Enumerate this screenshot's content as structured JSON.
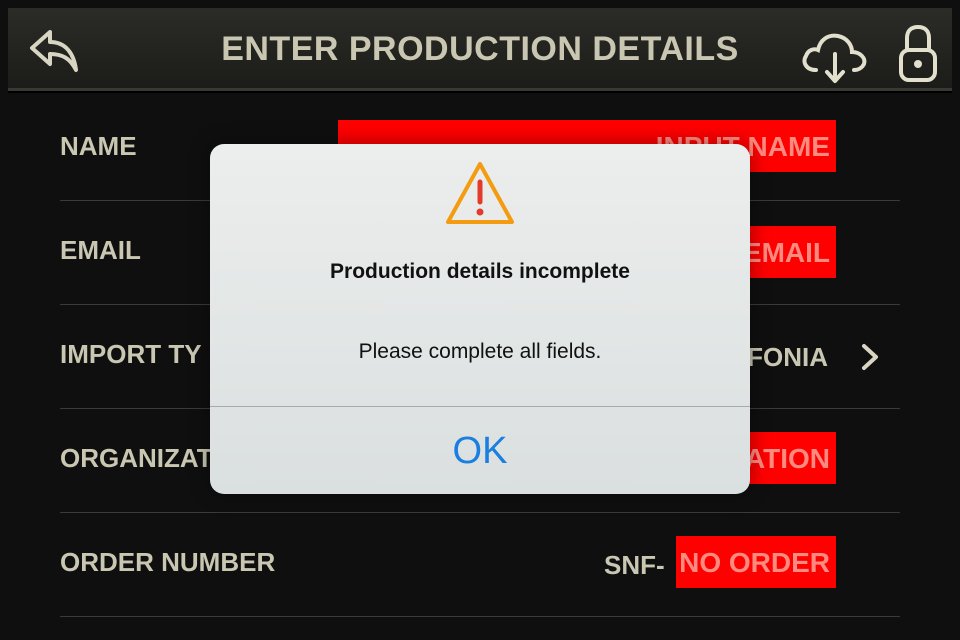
{
  "header": {
    "title": "ENTER PRODUCTION DETAILS",
    "back_icon": "back-arrow-icon",
    "cloud_icon": "cloud-download-icon",
    "lock_icon": "lock-icon"
  },
  "form": {
    "rows": [
      {
        "label": "NAME",
        "field_value": "INPUT NAME"
      },
      {
        "label": "EMAIL",
        "field_value": "EMAIL"
      },
      {
        "label": "IMPORT TY",
        "value": "FONIA"
      },
      {
        "label": "ORGANIZAT",
        "field_value": "ATION"
      },
      {
        "label": "ORDER NUMBER",
        "prefix": "SNF-",
        "field_value": "NO ORDER"
      }
    ]
  },
  "dialog": {
    "icon": "warning-triangle-icon",
    "title": "Production details incomplete",
    "message": "Please complete all fields.",
    "ok_label": "OK"
  },
  "colors": {
    "background": "#0f0f0f",
    "label_text": "#c9c7b2",
    "error_field": "#ff0000",
    "error_text": "#ff8a80",
    "dialog_button": "#1a7fe0",
    "warning": "#f39c12"
  }
}
